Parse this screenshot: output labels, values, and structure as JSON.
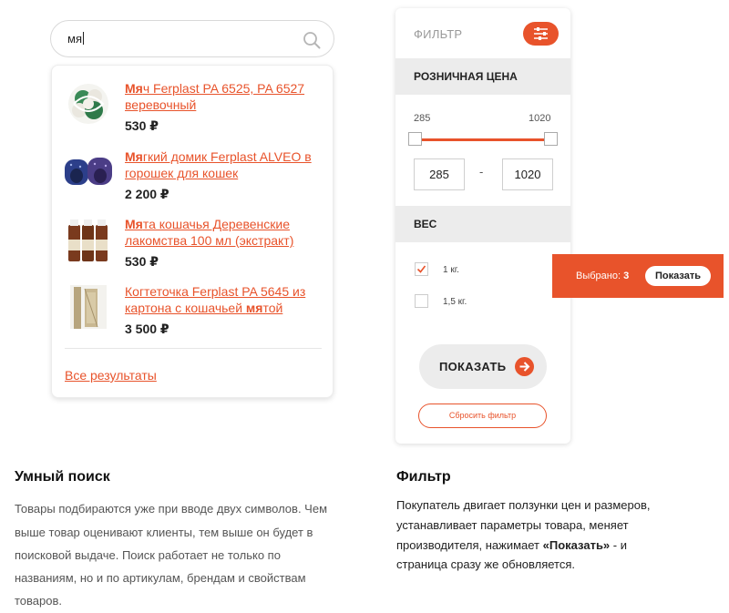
{
  "colors": {
    "accent": "#e8532b",
    "section_bg": "#ececec"
  },
  "search": {
    "query": "мя",
    "icon": "search-icon",
    "results": [
      {
        "highlight": "Мя",
        "rest": "ч Ferplast PA 6525, PA 6527 веревочный",
        "price": "530 ₽",
        "thumb": "rope-ball-toy"
      },
      {
        "highlight": "Мя",
        "rest": "гкий домик Ferplast ALVEO в горошек для кошек",
        "price": "2 200 ₽",
        "thumb": "cat-house"
      },
      {
        "highlight": "Мя",
        "rest": "та кошачья Деревенские лакомства 100 мл (экстракт)",
        "price": "530 ₽",
        "thumb": "catnip-bottles"
      },
      {
        "before": "Когтеточка Ferplast PA 5645 из картона с кошачьей ",
        "highlight": "мя",
        "after": "той",
        "price": "3 500 ₽",
        "thumb": "cardboard-scratcher"
      }
    ],
    "all_results": "Все результаты"
  },
  "filter": {
    "title": "ФИЛЬТР",
    "toggle_icon": "sliders-icon",
    "price_section": "РОЗНИЧНАЯ ЦЕНА",
    "range_min": "285",
    "range_max": "1020",
    "input_min": "285",
    "input_sep": "-",
    "input_max": "1020",
    "weight_section": "ВЕС",
    "weights": [
      {
        "label": "1 кг.",
        "checked": true
      },
      {
        "label": "1,5 кг.",
        "checked": false
      }
    ],
    "show_button": "ПОКАЗАТЬ",
    "reset_button": "Сбросить фильтр"
  },
  "popup": {
    "selected_label": "Выбрано:",
    "selected_count": "3",
    "button": "Показать"
  },
  "smart_search": {
    "heading": "Умный поиск",
    "lines": [
      "Товары подбираются уже при вводе двух символов. Чем",
      "выше товар оценивают клиенты, тем выше он будет в",
      "поисковой выдаче. Поиск работает не только по",
      "названиям, но и по артикулам, брендам и свойствам",
      "товаров."
    ]
  },
  "filter_info": {
    "heading": "Фильтр",
    "line1": "Покупатель двигает ползунки цен и размеров,",
    "line2": "устанавливает параметры товара, меняет",
    "line3_pre": "производителя, нажимает ",
    "line3_bold": "«Показать»",
    "line3_post": " - и",
    "line4": "страница сразу же  обновляется."
  }
}
